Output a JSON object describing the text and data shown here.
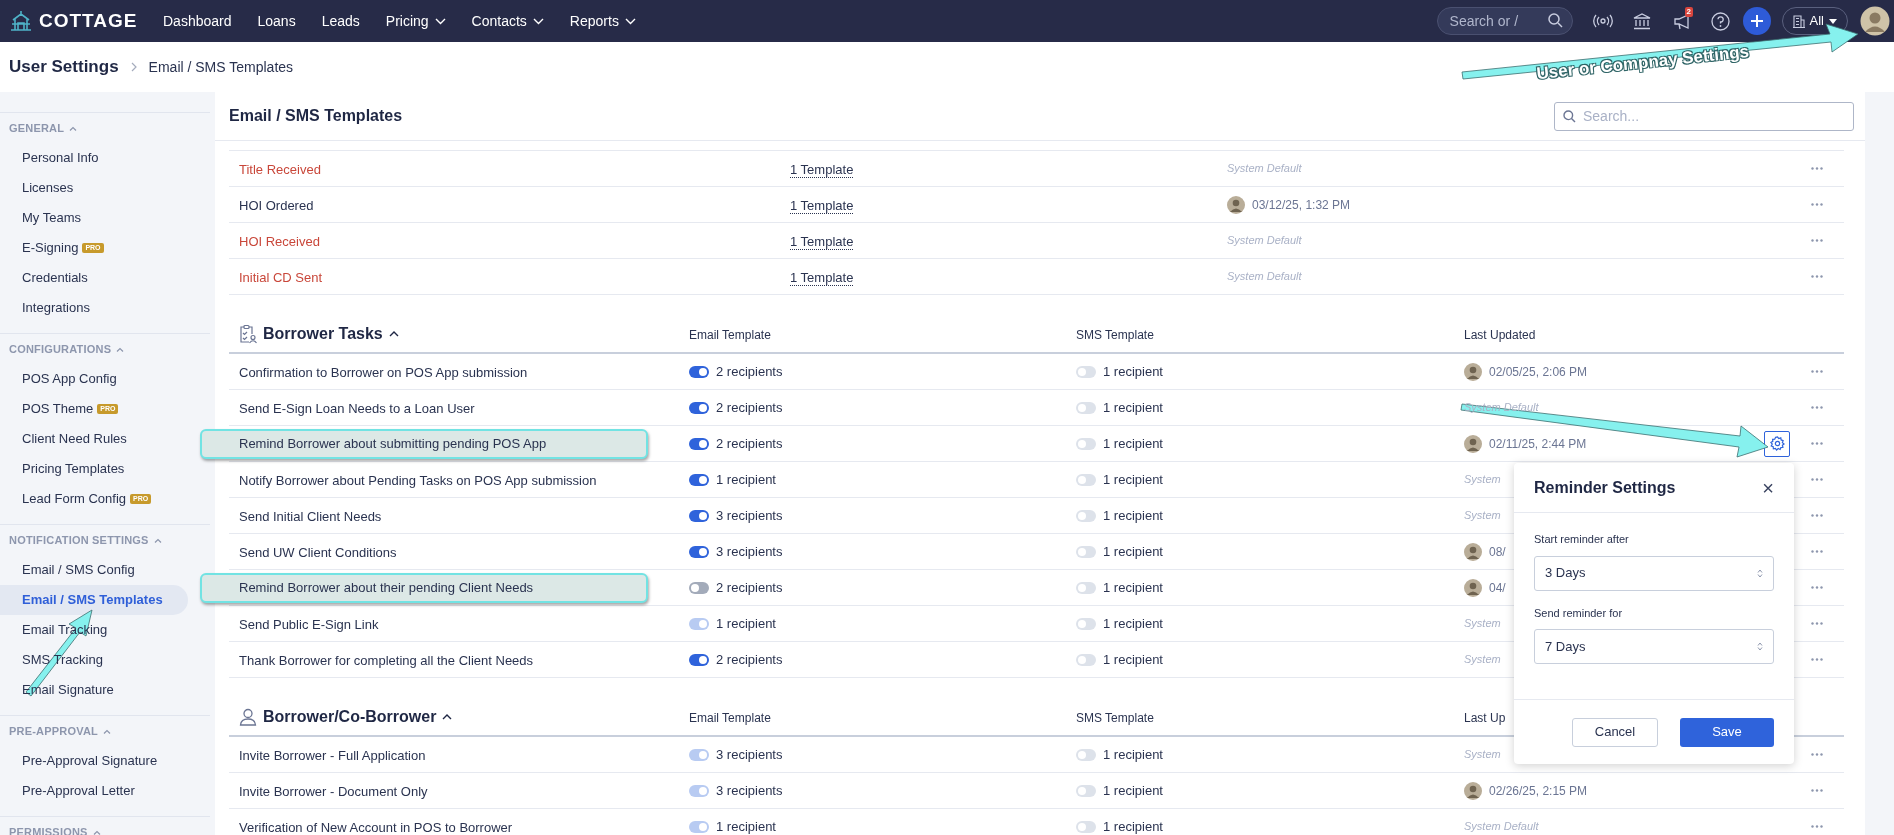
{
  "nav": {
    "logo": "COTTAGE",
    "items": [
      {
        "label": "Dashboard",
        "dropdown": false
      },
      {
        "label": "Loans",
        "dropdown": false
      },
      {
        "label": "Leads",
        "dropdown": false
      },
      {
        "label": "Pricing",
        "dropdown": true
      },
      {
        "label": "Contacts",
        "dropdown": true
      },
      {
        "label": "Reports",
        "dropdown": true
      }
    ],
    "search_placeholder": "Search or /",
    "notification_count": "2",
    "org_filter": "All"
  },
  "breadcrumb": {
    "title": "User Settings",
    "current": "Email / SMS Templates"
  },
  "sidebar": {
    "sections": [
      {
        "heading": "GENERAL",
        "items": [
          {
            "label": "Personal Info",
            "selected": false
          },
          {
            "label": "Licenses",
            "selected": false
          },
          {
            "label": "My Teams",
            "selected": false
          },
          {
            "label": "E-Signing",
            "selected": false,
            "badge": "PRO"
          },
          {
            "label": "Credentials",
            "selected": false
          },
          {
            "label": "Integrations",
            "selected": false
          }
        ]
      },
      {
        "heading": "CONFIGURATIONS",
        "items": [
          {
            "label": "POS App Config",
            "selected": false
          },
          {
            "label": "POS Theme",
            "selected": false,
            "badge": "PRO"
          },
          {
            "label": "Client Need Rules",
            "selected": false
          },
          {
            "label": "Pricing Templates",
            "selected": false
          },
          {
            "label": "Lead Form Config",
            "selected": false,
            "badge": "PRO"
          }
        ]
      },
      {
        "heading": "NOTIFICATION SETTINGS",
        "items": [
          {
            "label": "Email / SMS Config",
            "selected": false
          },
          {
            "label": "Email / SMS Templates",
            "selected": true
          },
          {
            "label": "Email Tracking",
            "selected": false
          },
          {
            "label": "SMS Tracking",
            "selected": false
          },
          {
            "label": "Email Signature",
            "selected": false
          }
        ]
      },
      {
        "heading": "PRE-APPROVAL",
        "items": [
          {
            "label": "Pre-Approval Signature",
            "selected": false
          },
          {
            "label": "Pre-Approval Letter",
            "selected": false
          }
        ]
      },
      {
        "heading": "PERMISSIONS"
      }
    ]
  },
  "content": {
    "title": "Email / SMS Templates",
    "search_placeholder": "Search...",
    "top_rows": [
      {
        "name": "Title Received",
        "alert": true,
        "templates": "1 Template",
        "updated": {
          "kind": "default",
          "text": "System Default"
        }
      },
      {
        "name": "HOI Ordered",
        "alert": false,
        "templates": "1 Template",
        "updated": {
          "kind": "user",
          "text": "03/12/25, 1:32 PM"
        }
      },
      {
        "name": "HOI Received",
        "alert": true,
        "templates": "1 Template",
        "updated": {
          "kind": "default",
          "text": "System Default"
        }
      },
      {
        "name": "Initial CD Sent",
        "alert": true,
        "templates": "1 Template",
        "updated": {
          "kind": "default",
          "text": "System Default"
        }
      }
    ],
    "groups": [
      {
        "title": "Borrower Tasks",
        "columns": [
          "Email Template",
          "SMS Template",
          "Last Updated"
        ],
        "rows": [
          {
            "name": "Confirmation to Borrower on POS App submission",
            "highlighted": false,
            "gear": false,
            "email": {
              "on": true,
              "disabled": false,
              "recipients": "2 recipients"
            },
            "sms": {
              "on": false,
              "disabled": true,
              "recipients": "1 recipient"
            },
            "updated": {
              "kind": "user",
              "text": "02/05/25, 2:06 PM"
            }
          },
          {
            "name": "Send E-Sign Loan Needs to a Loan User",
            "highlighted": false,
            "gear": false,
            "email": {
              "on": true,
              "disabled": false,
              "recipients": "2 recipients"
            },
            "sms": {
              "on": false,
              "disabled": true,
              "recipients": "1 recipient"
            },
            "updated": {
              "kind": "default",
              "text": "System Default"
            }
          },
          {
            "name": "Remind Borrower about submitting pending POS App",
            "highlighted": true,
            "gear": true,
            "email": {
              "on": true,
              "disabled": false,
              "recipients": "2 recipients"
            },
            "sms": {
              "on": false,
              "disabled": true,
              "recipients": "1 recipient"
            },
            "updated": {
              "kind": "user",
              "text": "02/11/25, 2:44 PM"
            }
          },
          {
            "name": "Notify Borrower about Pending Tasks on POS App submission",
            "highlighted": false,
            "gear": false,
            "email": {
              "on": true,
              "disabled": false,
              "recipients": "1 recipient"
            },
            "sms": {
              "on": false,
              "disabled": true,
              "recipients": "1 recipient"
            },
            "updated": {
              "kind": "default",
              "text": "System"
            }
          },
          {
            "name": "Send Initial Client Needs",
            "highlighted": false,
            "gear": false,
            "email": {
              "on": true,
              "disabled": false,
              "recipients": "3 recipients"
            },
            "sms": {
              "on": false,
              "disabled": true,
              "recipients": "1 recipient"
            },
            "updated": {
              "kind": "default",
              "text": "System"
            }
          },
          {
            "name": "Send UW Client Conditions",
            "highlighted": false,
            "gear": false,
            "email": {
              "on": true,
              "disabled": false,
              "recipients": "3 recipients"
            },
            "sms": {
              "on": false,
              "disabled": true,
              "recipients": "1 recipient"
            },
            "updated": {
              "kind": "user",
              "text": "08/"
            }
          },
          {
            "name": "Remind Borrower about their pending Client Needs",
            "highlighted": true,
            "gear": false,
            "email": {
              "on": false,
              "disabled": false,
              "recipients": "2 recipients"
            },
            "sms": {
              "on": false,
              "disabled": true,
              "recipients": "1 recipient"
            },
            "updated": {
              "kind": "user",
              "text": "04/"
            }
          },
          {
            "name": "Send Public E-Sign Link",
            "highlighted": false,
            "gear": false,
            "email": {
              "on": true,
              "disabled": true,
              "recipients": "1 recipient"
            },
            "sms": {
              "on": false,
              "disabled": true,
              "recipients": "1 recipient"
            },
            "updated": {
              "kind": "default",
              "text": "System"
            }
          },
          {
            "name": "Thank Borrower for completing all the Client Needs",
            "highlighted": false,
            "gear": false,
            "email": {
              "on": true,
              "disabled": false,
              "recipients": "2 recipients"
            },
            "sms": {
              "on": false,
              "disabled": true,
              "recipients": "1 recipient"
            },
            "updated": {
              "kind": "default",
              "text": "System"
            }
          }
        ]
      },
      {
        "title": "Borrower/Co-Borrower",
        "columns": [
          "Email Template",
          "SMS Template",
          "Last Up"
        ],
        "rows": [
          {
            "name": "Invite Borrower - Full Application",
            "highlighted": false,
            "gear": false,
            "email": {
              "on": true,
              "disabled": true,
              "recipients": "3 recipients"
            },
            "sms": {
              "on": false,
              "disabled": true,
              "recipients": "1 recipient"
            },
            "updated": {
              "kind": "default",
              "text": "System"
            }
          },
          {
            "name": "Invite Borrower - Document Only",
            "highlighted": false,
            "gear": false,
            "email": {
              "on": true,
              "disabled": true,
              "recipients": "3 recipients"
            },
            "sms": {
              "on": false,
              "disabled": true,
              "recipients": "1 recipient"
            },
            "updated": {
              "kind": "user",
              "text": "02/26/25, 2:15 PM"
            }
          },
          {
            "name": "Verification of New Account in POS to Borrower",
            "highlighted": false,
            "gear": false,
            "email": {
              "on": true,
              "disabled": true,
              "recipients": "1 recipient"
            },
            "sms": {
              "on": false,
              "disabled": true,
              "recipients": "1 recipient"
            },
            "updated": {
              "kind": "default",
              "text": "System Default"
            }
          }
        ]
      }
    ]
  },
  "popup": {
    "title": "Reminder Settings",
    "close": "×",
    "fields": [
      {
        "label": "Start reminder after",
        "value": "3 Days"
      },
      {
        "label": "Send reminder for",
        "value": "7 Days"
      }
    ],
    "cancel": "Cancel",
    "save": "Save"
  },
  "annotations": [
    {
      "text": "User or Compnay Settings"
    }
  ]
}
